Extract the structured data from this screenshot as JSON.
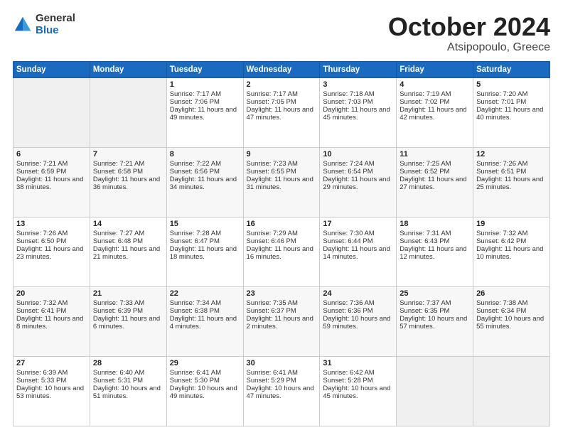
{
  "logo": {
    "general": "General",
    "blue": "Blue"
  },
  "title": "October 2024",
  "location": "Atsipopoulo, Greece",
  "days_header": [
    "Sunday",
    "Monday",
    "Tuesday",
    "Wednesday",
    "Thursday",
    "Friday",
    "Saturday"
  ],
  "weeks": [
    [
      {
        "day": "",
        "sunrise": "",
        "sunset": "",
        "daylight": ""
      },
      {
        "day": "",
        "sunrise": "",
        "sunset": "",
        "daylight": ""
      },
      {
        "day": "1",
        "sunrise": "Sunrise: 7:17 AM",
        "sunset": "Sunset: 7:06 PM",
        "daylight": "Daylight: 11 hours and 49 minutes."
      },
      {
        "day": "2",
        "sunrise": "Sunrise: 7:17 AM",
        "sunset": "Sunset: 7:05 PM",
        "daylight": "Daylight: 11 hours and 47 minutes."
      },
      {
        "day": "3",
        "sunrise": "Sunrise: 7:18 AM",
        "sunset": "Sunset: 7:03 PM",
        "daylight": "Daylight: 11 hours and 45 minutes."
      },
      {
        "day": "4",
        "sunrise": "Sunrise: 7:19 AM",
        "sunset": "Sunset: 7:02 PM",
        "daylight": "Daylight: 11 hours and 42 minutes."
      },
      {
        "day": "5",
        "sunrise": "Sunrise: 7:20 AM",
        "sunset": "Sunset: 7:01 PM",
        "daylight": "Daylight: 11 hours and 40 minutes."
      }
    ],
    [
      {
        "day": "6",
        "sunrise": "Sunrise: 7:21 AM",
        "sunset": "Sunset: 6:59 PM",
        "daylight": "Daylight: 11 hours and 38 minutes."
      },
      {
        "day": "7",
        "sunrise": "Sunrise: 7:21 AM",
        "sunset": "Sunset: 6:58 PM",
        "daylight": "Daylight: 11 hours and 36 minutes."
      },
      {
        "day": "8",
        "sunrise": "Sunrise: 7:22 AM",
        "sunset": "Sunset: 6:56 PM",
        "daylight": "Daylight: 11 hours and 34 minutes."
      },
      {
        "day": "9",
        "sunrise": "Sunrise: 7:23 AM",
        "sunset": "Sunset: 6:55 PM",
        "daylight": "Daylight: 11 hours and 31 minutes."
      },
      {
        "day": "10",
        "sunrise": "Sunrise: 7:24 AM",
        "sunset": "Sunset: 6:54 PM",
        "daylight": "Daylight: 11 hours and 29 minutes."
      },
      {
        "day": "11",
        "sunrise": "Sunrise: 7:25 AM",
        "sunset": "Sunset: 6:52 PM",
        "daylight": "Daylight: 11 hours and 27 minutes."
      },
      {
        "day": "12",
        "sunrise": "Sunrise: 7:26 AM",
        "sunset": "Sunset: 6:51 PM",
        "daylight": "Daylight: 11 hours and 25 minutes."
      }
    ],
    [
      {
        "day": "13",
        "sunrise": "Sunrise: 7:26 AM",
        "sunset": "Sunset: 6:50 PM",
        "daylight": "Daylight: 11 hours and 23 minutes."
      },
      {
        "day": "14",
        "sunrise": "Sunrise: 7:27 AM",
        "sunset": "Sunset: 6:48 PM",
        "daylight": "Daylight: 11 hours and 21 minutes."
      },
      {
        "day": "15",
        "sunrise": "Sunrise: 7:28 AM",
        "sunset": "Sunset: 6:47 PM",
        "daylight": "Daylight: 11 hours and 18 minutes."
      },
      {
        "day": "16",
        "sunrise": "Sunrise: 7:29 AM",
        "sunset": "Sunset: 6:46 PM",
        "daylight": "Daylight: 11 hours and 16 minutes."
      },
      {
        "day": "17",
        "sunrise": "Sunrise: 7:30 AM",
        "sunset": "Sunset: 6:44 PM",
        "daylight": "Daylight: 11 hours and 14 minutes."
      },
      {
        "day": "18",
        "sunrise": "Sunrise: 7:31 AM",
        "sunset": "Sunset: 6:43 PM",
        "daylight": "Daylight: 11 hours and 12 minutes."
      },
      {
        "day": "19",
        "sunrise": "Sunrise: 7:32 AM",
        "sunset": "Sunset: 6:42 PM",
        "daylight": "Daylight: 11 hours and 10 minutes."
      }
    ],
    [
      {
        "day": "20",
        "sunrise": "Sunrise: 7:32 AM",
        "sunset": "Sunset: 6:41 PM",
        "daylight": "Daylight: 11 hours and 8 minutes."
      },
      {
        "day": "21",
        "sunrise": "Sunrise: 7:33 AM",
        "sunset": "Sunset: 6:39 PM",
        "daylight": "Daylight: 11 hours and 6 minutes."
      },
      {
        "day": "22",
        "sunrise": "Sunrise: 7:34 AM",
        "sunset": "Sunset: 6:38 PM",
        "daylight": "Daylight: 11 hours and 4 minutes."
      },
      {
        "day": "23",
        "sunrise": "Sunrise: 7:35 AM",
        "sunset": "Sunset: 6:37 PM",
        "daylight": "Daylight: 11 hours and 2 minutes."
      },
      {
        "day": "24",
        "sunrise": "Sunrise: 7:36 AM",
        "sunset": "Sunset: 6:36 PM",
        "daylight": "Daylight: 10 hours and 59 minutes."
      },
      {
        "day": "25",
        "sunrise": "Sunrise: 7:37 AM",
        "sunset": "Sunset: 6:35 PM",
        "daylight": "Daylight: 10 hours and 57 minutes."
      },
      {
        "day": "26",
        "sunrise": "Sunrise: 7:38 AM",
        "sunset": "Sunset: 6:34 PM",
        "daylight": "Daylight: 10 hours and 55 minutes."
      }
    ],
    [
      {
        "day": "27",
        "sunrise": "Sunrise: 6:39 AM",
        "sunset": "Sunset: 5:33 PM",
        "daylight": "Daylight: 10 hours and 53 minutes."
      },
      {
        "day": "28",
        "sunrise": "Sunrise: 6:40 AM",
        "sunset": "Sunset: 5:31 PM",
        "daylight": "Daylight: 10 hours and 51 minutes."
      },
      {
        "day": "29",
        "sunrise": "Sunrise: 6:41 AM",
        "sunset": "Sunset: 5:30 PM",
        "daylight": "Daylight: 10 hours and 49 minutes."
      },
      {
        "day": "30",
        "sunrise": "Sunrise: 6:41 AM",
        "sunset": "Sunset: 5:29 PM",
        "daylight": "Daylight: 10 hours and 47 minutes."
      },
      {
        "day": "31",
        "sunrise": "Sunrise: 6:42 AM",
        "sunset": "Sunset: 5:28 PM",
        "daylight": "Daylight: 10 hours and 45 minutes."
      },
      {
        "day": "",
        "sunrise": "",
        "sunset": "",
        "daylight": ""
      },
      {
        "day": "",
        "sunrise": "",
        "sunset": "",
        "daylight": ""
      }
    ]
  ]
}
